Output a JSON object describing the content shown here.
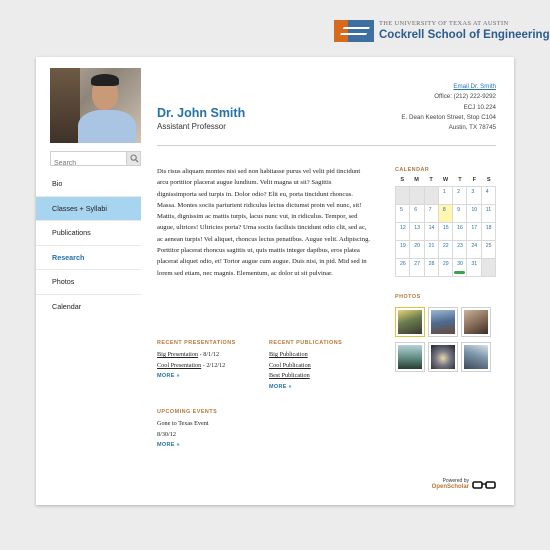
{
  "header": {
    "university": "THE UNIVERSITY OF TEXAS AT AUSTIN",
    "school": "Cockrell School of Engineering"
  },
  "profile": {
    "name": "Dr. John Smith",
    "title": "Assistant Professor",
    "contact": {
      "email_link": "Email Dr. Smith",
      "office_phone": "Office: (212) 222-9292",
      "room": "ECJ 10.224",
      "street": "E. Dean Keeton Street, Stop C104",
      "city": "Austin, TX 78745"
    }
  },
  "search": {
    "placeholder": "Search"
  },
  "nav": {
    "items": [
      {
        "label": "Bio"
      },
      {
        "label": "Classes + Syllabi"
      },
      {
        "label": "Publications"
      },
      {
        "label": "Research"
      },
      {
        "label": "Photos"
      },
      {
        "label": "Calendar"
      }
    ]
  },
  "bio_text": "Dis risus aliquam montes nisi sed non habitasse purus vel velit pid tincidunt arcu porttitor placerat augue lundium. Velit magna ut sit? Sagittis dignissimporta sed turpis in. Dolor odio? Elit eu, porta tincidunt rhoncus. Massa. Montes sociis parturient ridiculus lectus dictumst proin vel nunc, sit! Mattis, dignissim ac mattis turpis, lacus nunc vut, in ridiculus. Tempor, sed augue, ultrices! Ultricies porta? Urna sociis facilisis tincidunt odio clit, sed ac, ac aenean turpis! Vel aliquet, rhoncus lectus penatibus. Augue velit. Adipiscing. Porttitor placerat rhoncus sagittis ut, quis mattis integer dapibus, eros platea placerat aliquet odio, et! Tortor augue cum augue. Duis nisi, in pid. Mid sed in lorem sed etiam, nec magnis. Elementum, ac dolor ut sit pulvinar.",
  "recent_presentations": {
    "heading": "RECENT PRESENTATIONS",
    "items": [
      {
        "link": "Big Presentation",
        "date": " - 8/1/12"
      },
      {
        "link": "Cool Presentation",
        "date": " - 2/12/12"
      }
    ],
    "more": "MORE »"
  },
  "recent_publications": {
    "heading": "RECENT PUBLICATIONS",
    "items": [
      {
        "link": "Big Publication"
      },
      {
        "link": "Cool Publication"
      },
      {
        "link": "Best Publication"
      }
    ],
    "more": "MORE »"
  },
  "upcoming_events": {
    "heading": "UPCOMING EVENTS",
    "line1": "Gone to Texas Event",
    "line2": "8/30/12",
    "more": "MORE »"
  },
  "calendar": {
    "heading": "CALENDAR",
    "dow": [
      "S",
      "M",
      "T",
      "W",
      "T",
      "F",
      "S"
    ],
    "weeks": [
      [
        "",
        "",
        "",
        "1",
        "2",
        "3",
        "4"
      ],
      [
        "5",
        "6",
        "7",
        "8",
        "9",
        "10",
        "11"
      ],
      [
        "12",
        "13",
        "14",
        "15",
        "16",
        "17",
        "18"
      ],
      [
        "19",
        "20",
        "21",
        "22",
        "23",
        "24",
        "25"
      ],
      [
        "26",
        "27",
        "28",
        "29",
        "30",
        "31",
        ""
      ]
    ],
    "today": "8",
    "event_day": "30"
  },
  "photos": {
    "heading": "PHOTOS"
  },
  "footer": {
    "powered_by": "Powered by",
    "brand": "OpenScholar"
  },
  "colors": {
    "accent": "#2372a8",
    "nav_active": "#a7d4ee",
    "section_heading": "#b3783a",
    "event": "#3aa44a"
  }
}
